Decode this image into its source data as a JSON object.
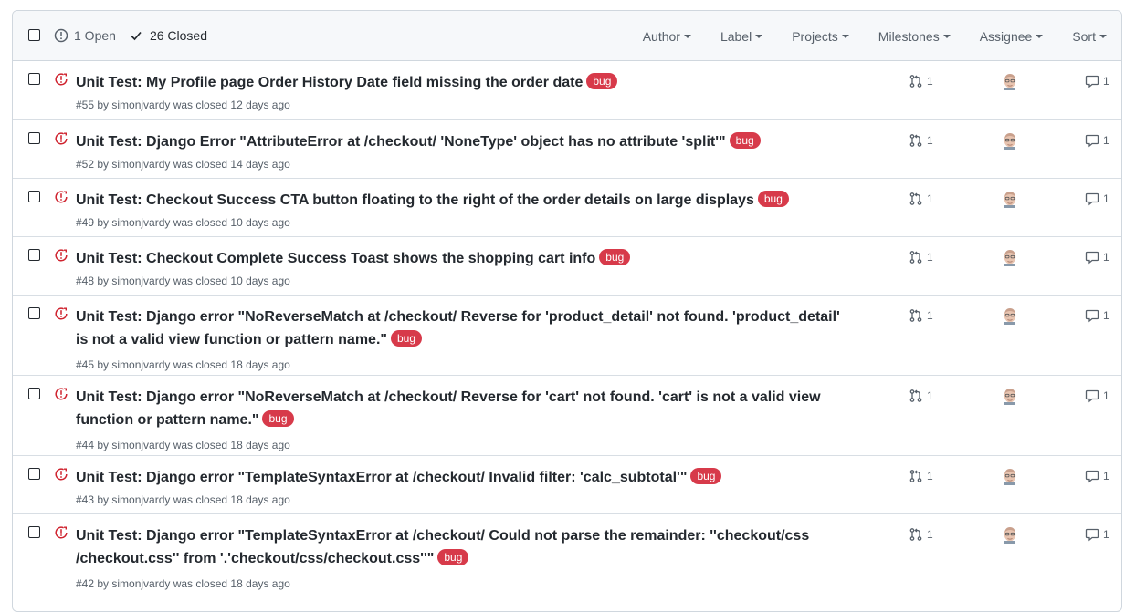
{
  "header": {
    "open_label": "1 Open",
    "closed_label": "26 Closed",
    "filters": [
      "Author",
      "Label",
      "Projects",
      "Milestones",
      "Assignee",
      "Sort"
    ]
  },
  "colors": {
    "closed_icon": "#cf222e",
    "bug_label": "#d73a4a"
  },
  "issues": [
    {
      "title": "Unit Test: My Profile page Order History Date field missing the order date",
      "label": "bug",
      "meta": "#55 by simonjvardy was closed 12 days ago",
      "linked_prs": "1",
      "comments": "1"
    },
    {
      "title": "Unit Test: Django Error \"AttributeError at /checkout/ 'NoneType' object has no attribute 'split'\"",
      "label": "bug",
      "meta": "#52 by simonjvardy was closed 14 days ago",
      "linked_prs": "1",
      "comments": "1"
    },
    {
      "title": "Unit Test: Checkout Success CTA button floating to the right of the order details on large displays",
      "label": "bug",
      "meta": "#49 by simonjvardy was closed 10 days ago",
      "linked_prs": "1",
      "comments": "1"
    },
    {
      "title": "Unit Test: Checkout Complete Success Toast shows the shopping cart info",
      "label": "bug",
      "meta": "#48 by simonjvardy was closed 10 days ago",
      "linked_prs": "1",
      "comments": "1"
    },
    {
      "title": "Unit Test: Django error \"NoReverseMatch at /checkout/ Reverse for 'product_detail' not found. 'product_detail' is not a valid view function or pattern name.\"",
      "label": "bug",
      "meta": "#45 by simonjvardy was closed 18 days ago",
      "linked_prs": "1",
      "comments": "1"
    },
    {
      "title": "Unit Test: Django error \"NoReverseMatch at /checkout/ Reverse for 'cart' not found. 'cart' is not a valid view function or pattern name.\"",
      "label": "bug",
      "meta": "#44 by simonjvardy was closed 18 days ago",
      "linked_prs": "1",
      "comments": "1"
    },
    {
      "title": "Unit Test: Django error \"TemplateSyntaxError at /checkout/ Invalid filter: 'calc_subtotal'\"",
      "label": "bug",
      "meta": "#43 by simonjvardy was closed 18 days ago",
      "linked_prs": "1",
      "comments": "1"
    },
    {
      "title": "Unit Test: Django error \"TemplateSyntaxError at /checkout/ Could not parse the remainder: ''checkout/css /checkout.css'' from '.'checkout/css/checkout.css''\"",
      "label": "bug",
      "meta": "#42 by simonjvardy was closed 18 days ago",
      "linked_prs": "1",
      "comments": "1"
    }
  ]
}
